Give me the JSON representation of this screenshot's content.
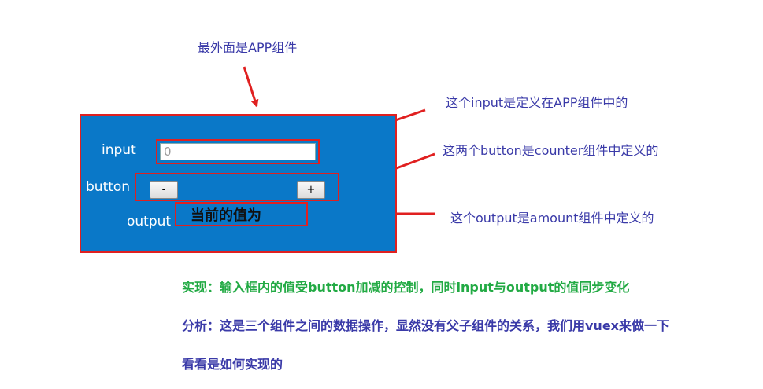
{
  "annotations": {
    "app_note": "最外面是APP组件",
    "input_note": "这个input是定义在APP组件中的",
    "button_note": "这两个button是counter组件中定义的",
    "output_note": "这个output是amount组件中定义的"
  },
  "app": {
    "input_label": "input",
    "input_value": "0",
    "button_label": "button",
    "minus_label": "-",
    "plus_label": "+",
    "output_label": "output",
    "output_text": "当前的值为"
  },
  "description": {
    "line1": "实现：输入框内的值受button加减的控制，同时input与output的值同步变化",
    "line2": "分析：这是三个组件之间的数据操作，显然没有父子组件的关系，我们用vuex来做一下",
    "line3": "看看是如何实现的"
  },
  "colors": {
    "app_background": "#0a78c8",
    "highlight_border": "#e02020",
    "arrow": "#e02020",
    "note_text": "#3a3aa8",
    "line1_text": "#22aa44"
  }
}
